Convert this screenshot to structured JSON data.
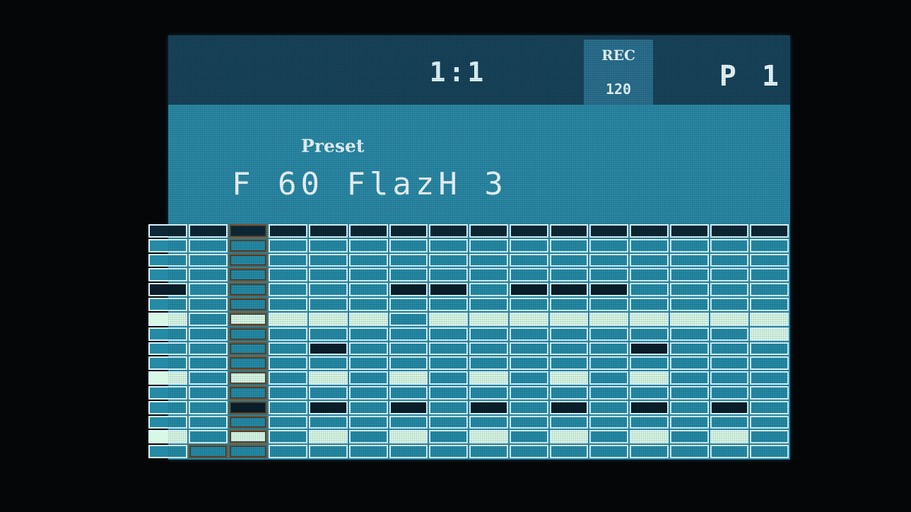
{
  "header": {
    "position": "1:1",
    "rec_label": "REC",
    "tempo": "120",
    "pattern": "P 1"
  },
  "parameter": {
    "label": "Preset",
    "value": "F 60 FlazH 3"
  },
  "step_grid": {
    "columns": 16,
    "rows": 16,
    "cursor_column": 2,
    "cursor_row": 15,
    "cursor_cell_column": 1,
    "header_row": "black",
    "rows_states": [
      [
        "black",
        "black",
        "black",
        "black",
        "black",
        "black",
        "black",
        "black",
        "black",
        "black",
        "black",
        "black",
        "black",
        "black",
        "black",
        "black"
      ],
      [
        "off",
        "off",
        "off",
        "off",
        "off",
        "off",
        "off",
        "off",
        "off",
        "off",
        "off",
        "off",
        "off",
        "off",
        "off",
        "off"
      ],
      [
        "off",
        "off",
        "off",
        "off",
        "off",
        "off",
        "off",
        "off",
        "off",
        "off",
        "off",
        "off",
        "off",
        "off",
        "off",
        "off"
      ],
      [
        "off",
        "off",
        "off",
        "off",
        "off",
        "off",
        "off",
        "off",
        "off",
        "off",
        "off",
        "off",
        "off",
        "off",
        "off",
        "off"
      ],
      [
        "black",
        "off",
        "off",
        "off",
        "off",
        "off",
        "black",
        "black",
        "off",
        "black",
        "black",
        "black",
        "off",
        "off",
        "off",
        "off"
      ],
      [
        "off",
        "off",
        "off",
        "off",
        "off",
        "off",
        "off",
        "off",
        "off",
        "off",
        "off",
        "off",
        "off",
        "off",
        "off",
        "off"
      ],
      [
        "on",
        "off",
        "on",
        "on",
        "on",
        "on",
        "off",
        "on",
        "on",
        "on",
        "on",
        "on",
        "on",
        "on",
        "on",
        "on"
      ],
      [
        "off",
        "off",
        "off",
        "off",
        "off",
        "off",
        "off",
        "off",
        "off",
        "off",
        "off",
        "off",
        "off",
        "off",
        "off",
        "on"
      ],
      [
        "off",
        "off",
        "off",
        "off",
        "black",
        "off",
        "off",
        "off",
        "off",
        "off",
        "off",
        "off",
        "black",
        "off",
        "off",
        "off"
      ],
      [
        "off",
        "off",
        "off",
        "off",
        "off",
        "off",
        "off",
        "off",
        "off",
        "off",
        "off",
        "off",
        "off",
        "off",
        "off",
        "off"
      ],
      [
        "on",
        "off",
        "on",
        "off",
        "on",
        "off",
        "on",
        "off",
        "on",
        "off",
        "on",
        "off",
        "on",
        "off",
        "off",
        "off"
      ],
      [
        "off",
        "off",
        "off",
        "off",
        "off",
        "off",
        "off",
        "off",
        "off",
        "off",
        "off",
        "off",
        "off",
        "off",
        "off",
        "off"
      ],
      [
        "off",
        "off",
        "black",
        "off",
        "black",
        "off",
        "black",
        "off",
        "black",
        "off",
        "black",
        "off",
        "black",
        "off",
        "black",
        "off"
      ],
      [
        "off",
        "off",
        "off",
        "off",
        "off",
        "off",
        "off",
        "off",
        "off",
        "off",
        "off",
        "off",
        "off",
        "off",
        "off",
        "off"
      ],
      [
        "on",
        "off",
        "on",
        "off",
        "on",
        "off",
        "on",
        "off",
        "on",
        "off",
        "on",
        "off",
        "on",
        "off",
        "on",
        "off"
      ],
      [
        "off",
        "off",
        "off",
        "off",
        "off",
        "off",
        "off",
        "off",
        "off",
        "off",
        "off",
        "off",
        "off",
        "off",
        "off",
        "off"
      ]
    ]
  },
  "colors": {
    "lcd_bg": "#2a89a6",
    "topbar_bg": "#17435a",
    "cell_on": "#d8f8e6",
    "cell_black": "#0a1f2b",
    "cursor_border": "#7a5530"
  }
}
